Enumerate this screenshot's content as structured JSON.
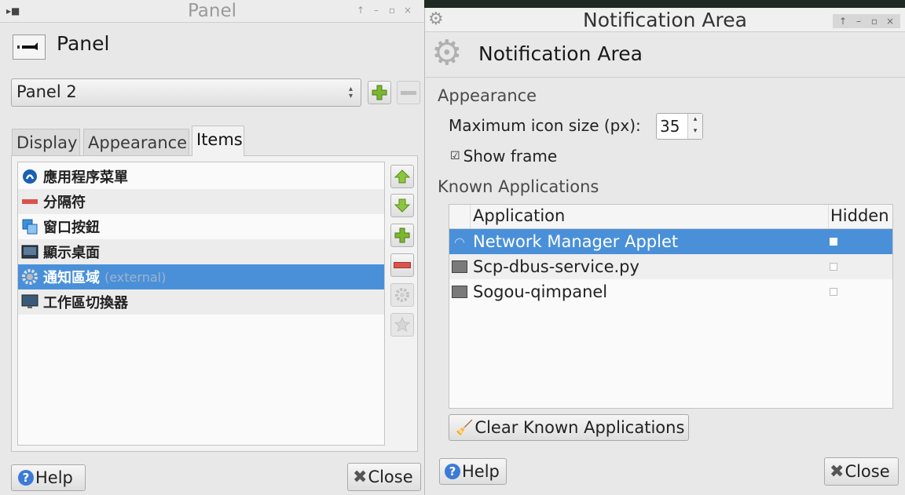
{
  "panel_window": {
    "title": "Panel",
    "header_title": "Panel",
    "panel_select": "Panel 2",
    "tabs": [
      {
        "label": "Display"
      },
      {
        "label": "Appearance"
      },
      {
        "label": "Items"
      }
    ],
    "items": [
      {
        "label": "應用程序菜單",
        "icon": "app-menu-icon"
      },
      {
        "label": "分隔符",
        "icon": "separator-icon"
      },
      {
        "label": "窗口按鈕",
        "icon": "window-buttons-icon"
      },
      {
        "label": "顯示桌面",
        "icon": "show-desktop-icon"
      },
      {
        "label": "通知區域",
        "note": "(external)",
        "icon": "gear-icon"
      },
      {
        "label": "工作區切換器",
        "icon": "workspace-switcher-icon"
      }
    ],
    "help_label": "Help",
    "close_label": "Close"
  },
  "notif_window": {
    "title": "Notification Area",
    "header_title": "Notification Area",
    "appearance_heading": "Appearance",
    "max_icon_label": "Maximum icon size (px):",
    "max_icon_value": "35",
    "show_frame_label": "Show frame",
    "show_frame_checked": true,
    "known_heading": "Known Applications",
    "columns": [
      "Application",
      "Hidden"
    ],
    "apps": [
      {
        "name": "Network Manager Applet",
        "icon": "wifi-icon",
        "hidden": false
      },
      {
        "name": "Scp-dbus-service.py",
        "icon": "generic-app-icon",
        "hidden": false
      },
      {
        "name": "Sogou-qimpanel",
        "icon": "generic-app-icon",
        "hidden": false
      }
    ],
    "clear_label": "Clear Known Applications",
    "help_label": "Help",
    "close_label": "Close"
  },
  "colors": {
    "selection": "#4a90d9",
    "add": "#7cb82f",
    "remove": "#d9534f"
  }
}
